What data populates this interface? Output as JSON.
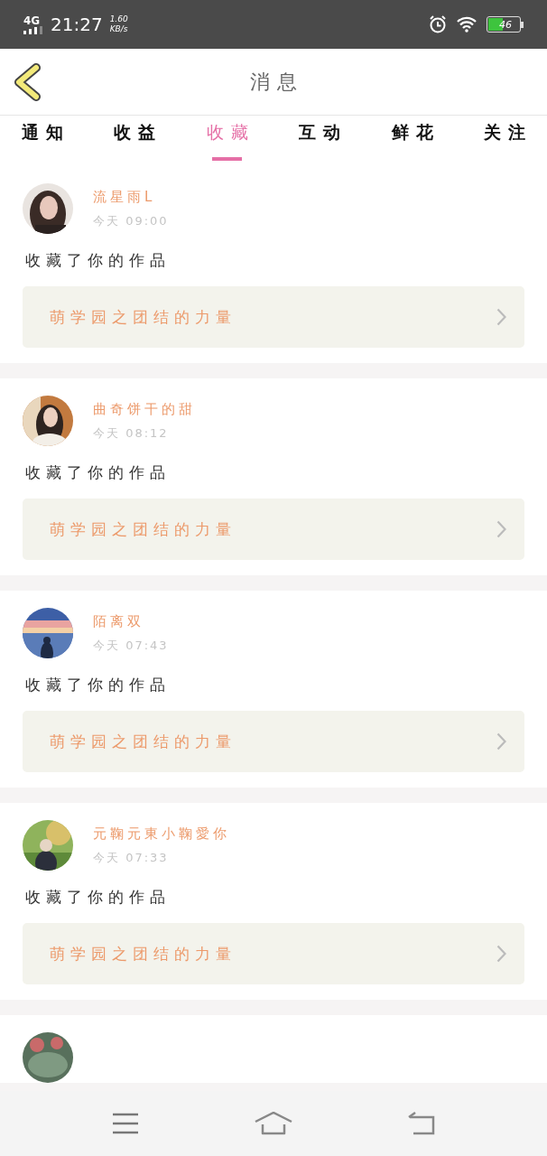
{
  "status_bar": {
    "network": "4G",
    "time": "21:27",
    "speed": "1.60",
    "speed_unit": "KB/s",
    "battery": "46"
  },
  "header": {
    "title": "消息"
  },
  "tabs": [
    {
      "label": "通知",
      "selected": false
    },
    {
      "label": "收益",
      "selected": false
    },
    {
      "label": "收藏",
      "selected": true
    },
    {
      "label": "互动",
      "selected": false
    },
    {
      "label": "鲜花",
      "selected": false
    },
    {
      "label": "关注",
      "selected": false
    }
  ],
  "items": [
    {
      "avatar": {
        "kind": "picture"
      },
      "name": "流星雨L",
      "time": "今天 09:00",
      "action": "收藏了你的作品",
      "work": "萌学园之团结的力量"
    },
    {
      "avatar": {
        "kind": "picture"
      },
      "name": "曲奇饼干的甜",
      "time": "今天 08:12",
      "action": "收藏了你的作品",
      "work": "萌学园之团结的力量"
    },
    {
      "avatar": {
        "kind": "picture"
      },
      "name": "陌离双",
      "time": "今天 07:43",
      "action": "收藏了你的作品",
      "work": "萌学园之团结的力量"
    },
    {
      "avatar": {
        "kind": "picture"
      },
      "name": "元鞠元東小鞠愛你",
      "time": "今天 07:33",
      "action": "收藏了你的作品",
      "work": "萌学园之团结的力量"
    },
    {
      "avatar": {
        "kind": "picture"
      }
    }
  ]
}
